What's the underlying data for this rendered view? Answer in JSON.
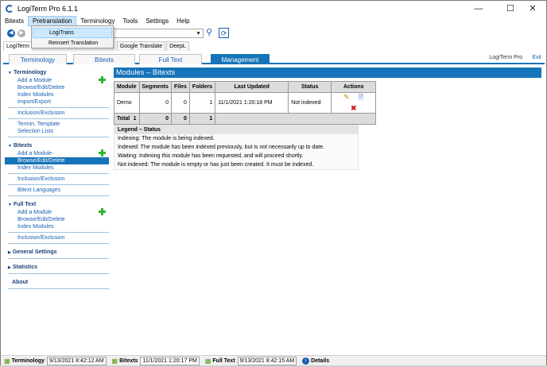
{
  "window": {
    "title": "LogiTerm Pro 6.1.1",
    "controls": [
      "minimize-icon",
      "maximize-icon",
      "close-icon"
    ]
  },
  "menu": {
    "items": [
      "Bitexts",
      "Pretranslation",
      "Terminology",
      "Tools",
      "Settings",
      "Help"
    ],
    "active_index": 1
  },
  "dropdown": {
    "items": [
      "LogiTrans",
      "Reinsert Translation"
    ],
    "highlighted_index": 0
  },
  "toolbar": {
    "search_value": "",
    "icons": [
      "back-icon",
      "forward-icon",
      "search-icon",
      "refresh-icon"
    ]
  },
  "top_tabs": [
    "LogiTerm",
    "",
    "nsSearch",
    "Google Translate",
    "DeepL"
  ],
  "nav": {
    "tabs": [
      "Terminology",
      "Bitexts",
      "Full Text",
      "Management"
    ],
    "active_index": 3,
    "brand": "LogiTerm Pro",
    "exit": "Exit"
  },
  "sidebar": {
    "terminology": {
      "title": "Terminology",
      "links": [
        "Add a Module",
        "Browse/Edit/Delete",
        "Index Modules",
        "Import/Export"
      ],
      "extra": [
        "Inclusion/Exclusion"
      ],
      "extra2": [
        "Termin. Template",
        "Selection Lists"
      ]
    },
    "bitexts": {
      "title": "Bitexts",
      "links": [
        "Add a Module",
        "Browse/Edit/Delete",
        "Index Modules"
      ],
      "selected_index": 1,
      "extra": [
        "Inclusion/Exclusion"
      ],
      "extra2": [
        "Bitext Languages"
      ]
    },
    "fulltext": {
      "title": "Full Text",
      "links": [
        "Add a Module",
        "Browse/Edit/Delete",
        "Index Modules"
      ],
      "extra": [
        "Inclusion/Exclusion"
      ]
    },
    "general": {
      "title": "General Settings"
    },
    "statistics": {
      "title": "Statistics"
    },
    "about": {
      "title": "About"
    }
  },
  "main": {
    "section_title": "Modules – Bitexts",
    "table": {
      "headers": [
        "Module",
        "Segments",
        "Files",
        "Folders",
        "Last Updated",
        "Status",
        "Actions"
      ],
      "rows": [
        {
          "module": "Demo",
          "segments": "0",
          "files": "0",
          "folders": "1",
          "last_updated": "11/1/2021 1:20:18 PM",
          "status": "Not indexed",
          "actions": [
            "edit-icon",
            "index-icon",
            "delete-icon"
          ]
        }
      ],
      "total": {
        "label": "Total",
        "count": "1",
        "segments": "0",
        "files": "0",
        "folders": "1"
      }
    },
    "legend": {
      "title": "Legend – Status",
      "lines": [
        "Indexing: The module is being indexed.",
        "Indexed: The module has been indexed previously, but is not necessarily up to date.",
        "Waiting: Indexing this module has been requested, and will proceed shortly.",
        "Not indexed: The module is empty or has just been created. It must be indexed."
      ]
    }
  },
  "status": {
    "terminology_label": "Terminology",
    "terminology_time": "9/13/2021 8:42:12 AM",
    "bitexts_label": "Bitexts",
    "bitexts_time": "11/1/2021 1:20:17 PM",
    "fulltext_label": "Full Text",
    "fulltext_time": "9/13/2021 8:42:15 AM",
    "details_label": "Details"
  },
  "colors": {
    "accent": "#1674b8",
    "link": "#1a5fb4",
    "add_green": "#2fb52f",
    "delete_red": "#c62828"
  }
}
